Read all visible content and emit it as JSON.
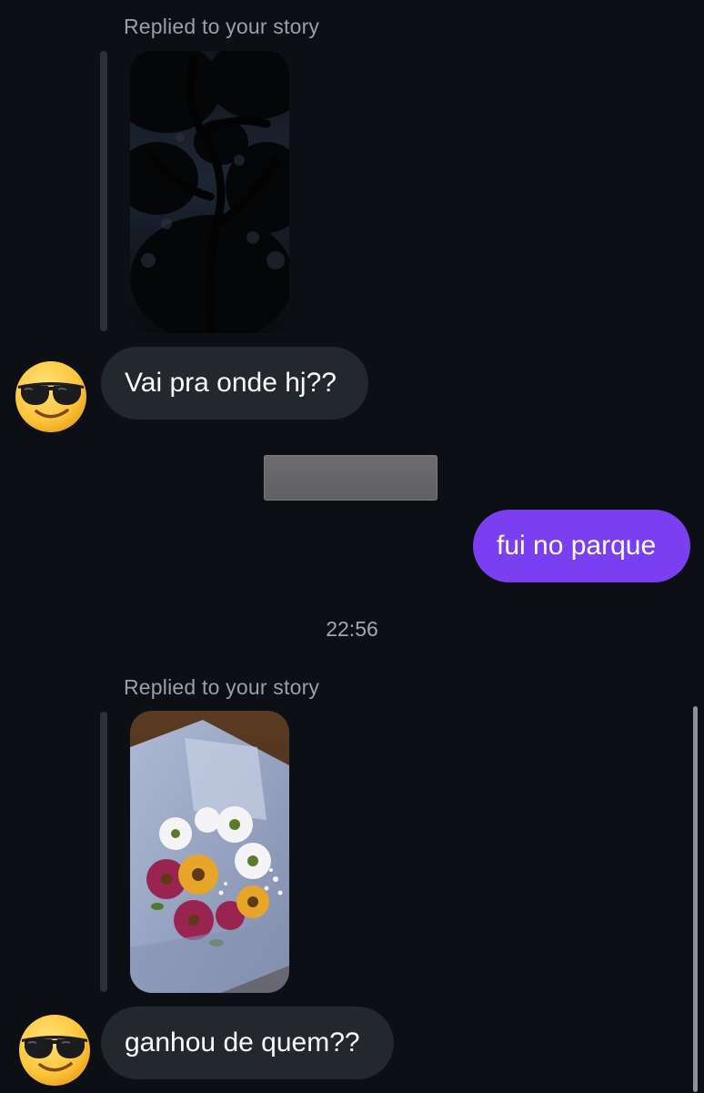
{
  "messages": [
    {
      "reply_label": "Replied to your story",
      "story_image": "dark tree canopy at night",
      "text": "Vai pra onde hj??",
      "avatar": "sunglasses-emoji-icon"
    },
    {
      "text": "fui no parque",
      "direction": "outgoing"
    },
    {
      "reply_label": "Replied to your story",
      "story_image": "flower bouquet wrapped in paper",
      "text": "ganhou de quem??",
      "avatar": "sunglasses-emoji-icon"
    }
  ],
  "timestamp": "22:56",
  "colors": {
    "background": "#0c0f14",
    "incoming_bubble": "#23272e",
    "outgoing_bubble": "#7b3ff2"
  }
}
